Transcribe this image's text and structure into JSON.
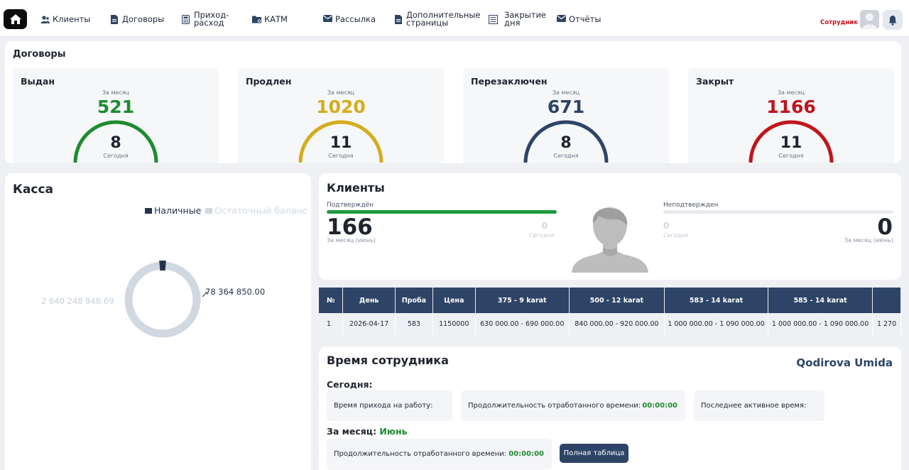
{
  "nav": {
    "items": [
      {
        "label": "Клиенты",
        "icon": "users-icon"
      },
      {
        "label": "Договоры",
        "icon": "file-icon"
      },
      {
        "label": "Приход-расход",
        "icon": "calculator-icon"
      },
      {
        "label": "КАТМ",
        "icon": "folder-icon"
      },
      {
        "label": "Рассылка",
        "icon": "envelope-icon"
      },
      {
        "label": "Дополнительные страницы",
        "icon": "page-icon"
      },
      {
        "label": "Закрытие дня",
        "icon": "list-icon"
      },
      {
        "label": "Отчёты",
        "icon": "envelope-icon"
      }
    ],
    "user_role": "Сотрудник"
  },
  "contracts": {
    "title": "Договоры",
    "month_label": "За месяц",
    "today_label": "Сегодня",
    "cards": [
      {
        "title": "Выдан",
        "month": "521",
        "today": "8",
        "color": "#1e8b2f"
      },
      {
        "title": "Продлен",
        "month": "1020",
        "today": "11",
        "color": "#d4ac1e"
      },
      {
        "title": "Перезаключен",
        "month": "671",
        "today": "8",
        "color": "#2d4466"
      },
      {
        "title": "Закрыт",
        "month": "1166",
        "today": "11",
        "color": "#c1141b"
      }
    ]
  },
  "kassa": {
    "title": "Касса",
    "legend": [
      {
        "label": "Наличные",
        "color": "#26324a"
      },
      {
        "label": "Остаточный баланс",
        "color": "#d0d8e2"
      }
    ],
    "chart_data": {
      "type": "pie",
      "categories": [
        "Наличные",
        "Остаточный баланс"
      ],
      "values": [
        78364850.0,
        2640248948.69
      ],
      "labels": [
        "78 364 850.00",
        "2 640 248 948.69"
      ]
    }
  },
  "clients": {
    "title": "Клиенты",
    "confirmed": {
      "label": "Подтверждён",
      "month": "166",
      "month_label": "За месяц (июнь)",
      "today": "0",
      "today_label": "Сегодня"
    },
    "unconfirmed": {
      "label": "Неподтвержден",
      "month": "0",
      "month_label": "За месяц (июнь)",
      "today": "0",
      "today_label": "Сегодня"
    }
  },
  "prices_table": {
    "headers": [
      "№",
      "День",
      "Проба",
      "Цена",
      "375 - 9 karat",
      "500 - 12 karat",
      "583 - 14 karat",
      "585 - 14 karat",
      ""
    ],
    "rows": [
      [
        "1",
        "2026-04-17",
        "583",
        "1150000",
        "630 000.00 - 690 000.00",
        "840 000.00 - 920 000.00",
        "1 000 000.00 - 1 090 000.00",
        "1 000 000.00 - 1 090 000.00",
        "1 270"
      ]
    ]
  },
  "employee_time": {
    "title": "Время сотрудника",
    "employee_name": "Qodirova Umida",
    "today_header": "Сегодня:",
    "arrival_label": "Время прихода на работу:",
    "worked_label": "Продолжительность отработанного времени:",
    "worked_today": "00:00:00",
    "last_active_label": "Последнее активное время:",
    "month_header": "За месяц:",
    "month_name": "Июнь",
    "worked_month": "00:00:00",
    "full_table_button": "Полная таблица"
  }
}
